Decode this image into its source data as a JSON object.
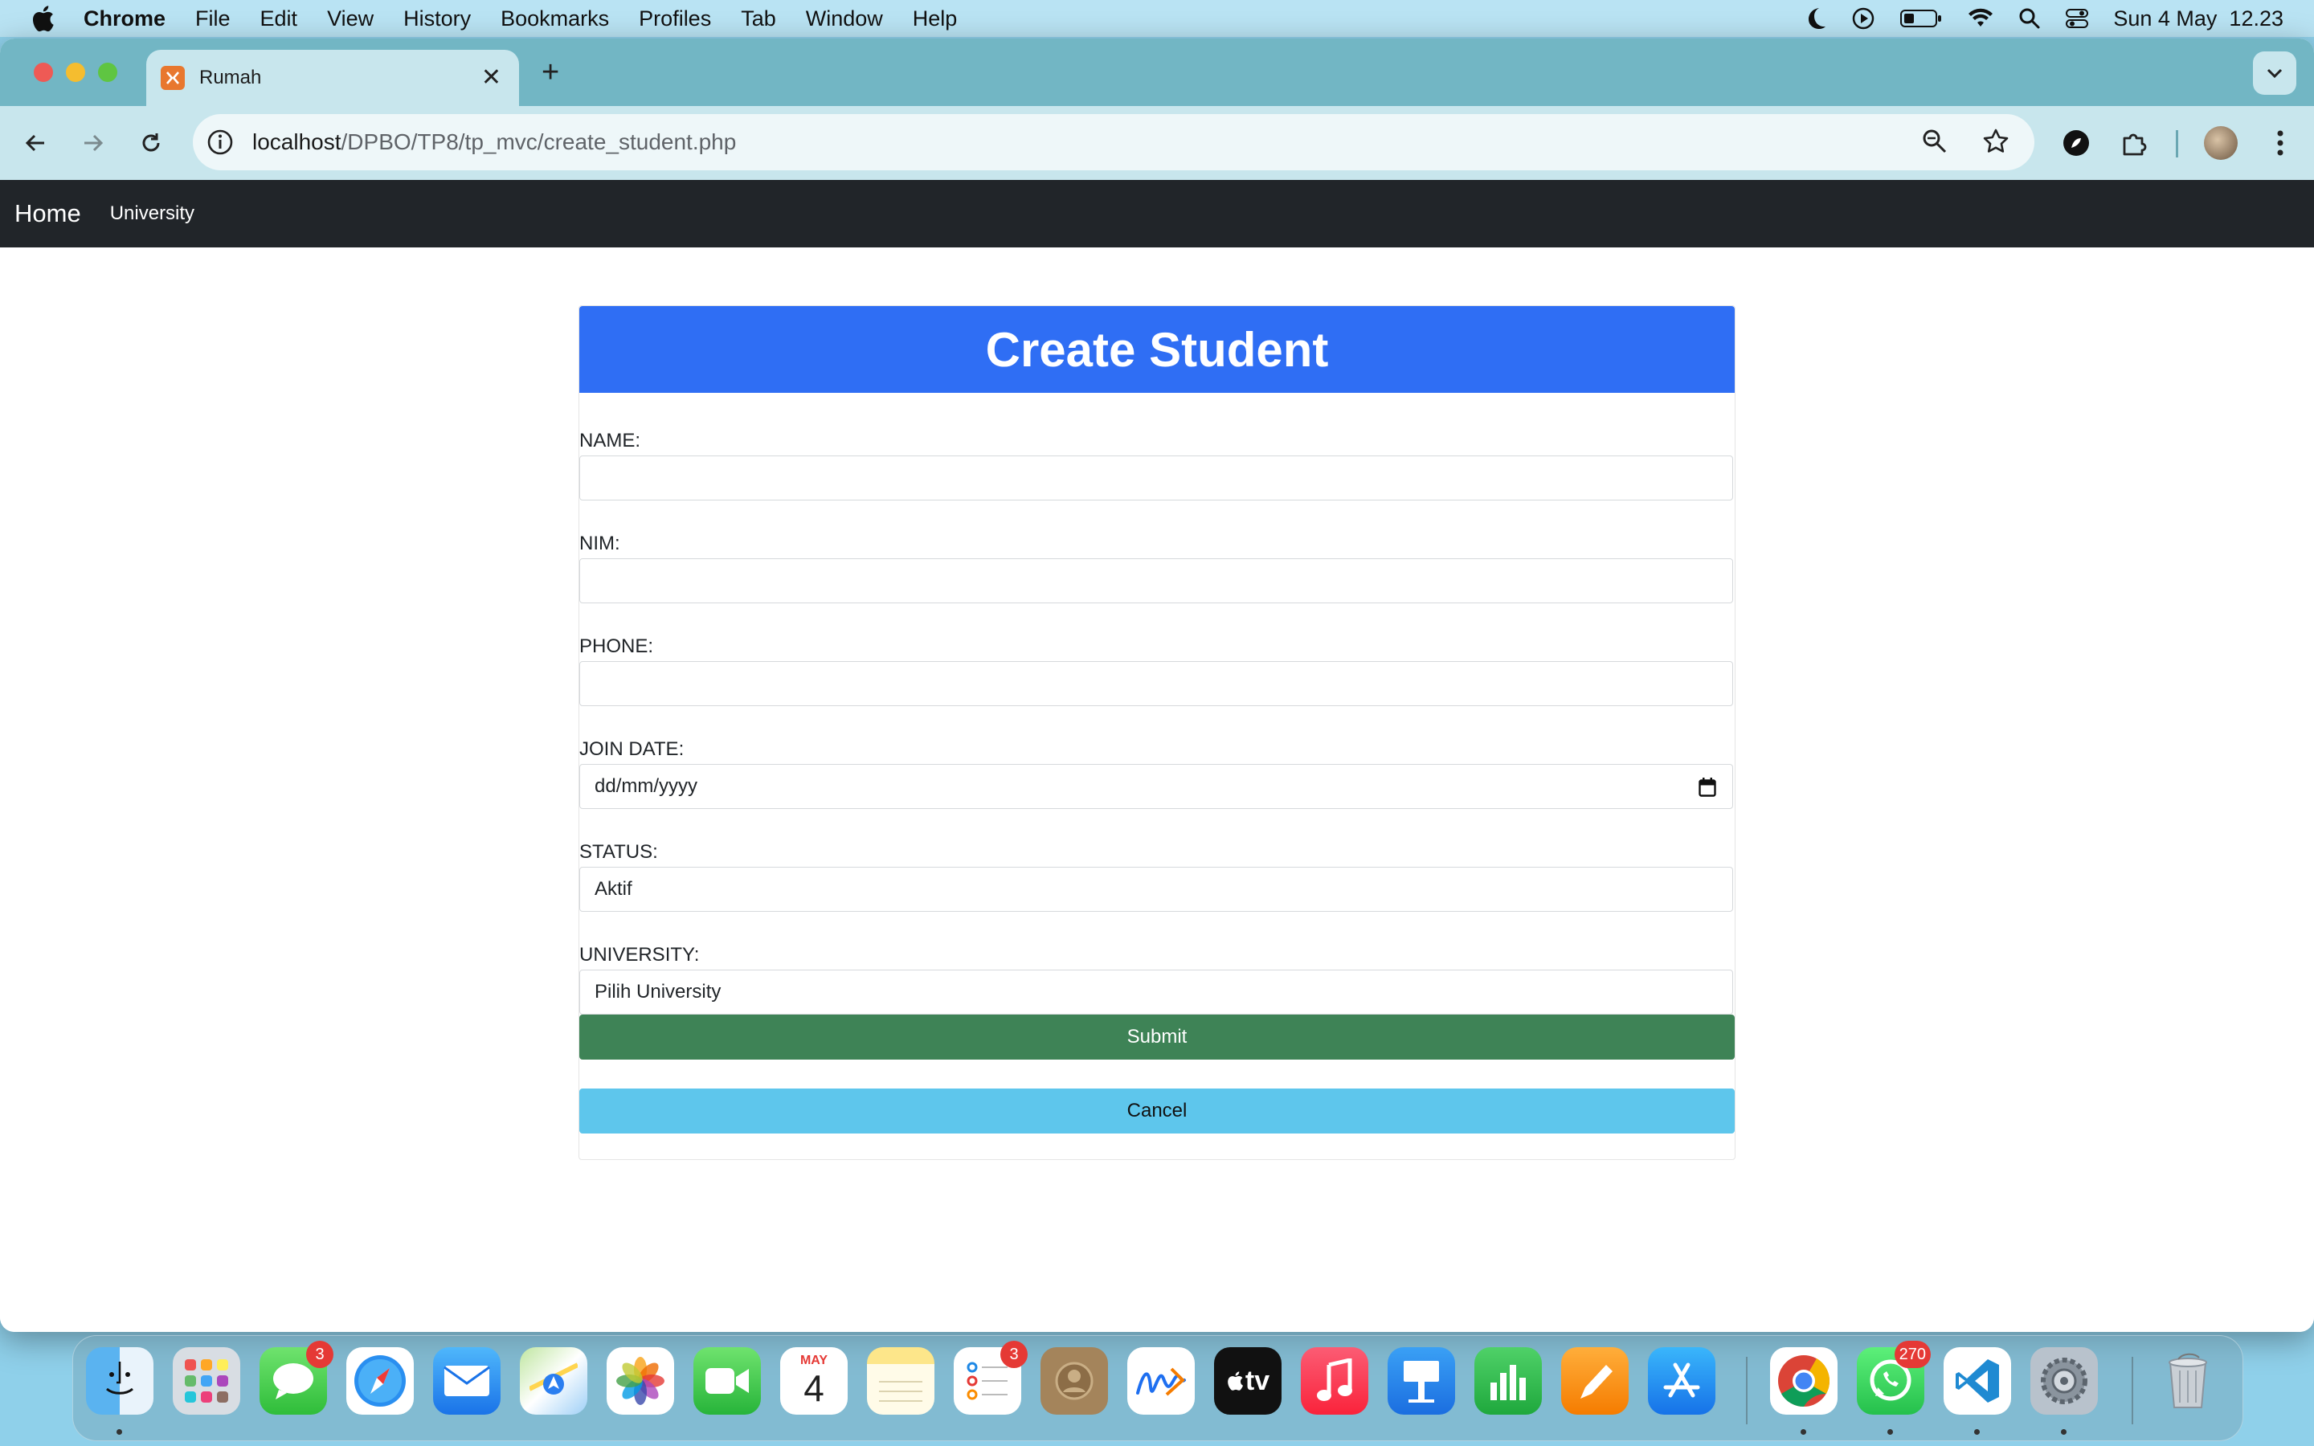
{
  "menubar": {
    "app_name": "Chrome",
    "items": [
      "File",
      "Edit",
      "View",
      "History",
      "Bookmarks",
      "Profiles",
      "Tab",
      "Window",
      "Help"
    ],
    "datetime": "Sun 4 May  12.23"
  },
  "browser": {
    "tab_title": "Rumah",
    "url_host": "localhost",
    "url_path": "/DPBO/TP8/tp_mvc/create_student.php"
  },
  "site_nav": {
    "brand": "Home",
    "links": [
      "University"
    ]
  },
  "form": {
    "title": "Create Student",
    "fields": [
      {
        "label": "NAME:",
        "value": ""
      },
      {
        "label": "NIM:",
        "value": ""
      },
      {
        "label": "PHONE:",
        "value": ""
      },
      {
        "label": "JOIN DATE:",
        "value": "dd/mm/yyyy"
      },
      {
        "label": "STATUS:",
        "value": "Aktif"
      },
      {
        "label": "UNIVERSITY:",
        "value": "Pilih University"
      }
    ],
    "submit_label": "Submit",
    "cancel_label": "Cancel"
  },
  "dock": {
    "apps": [
      {
        "name": "finder-icon"
      },
      {
        "name": "launchpad-icon"
      },
      {
        "name": "messages-icon",
        "badge": "3"
      },
      {
        "name": "safari-icon"
      },
      {
        "name": "mail-icon"
      },
      {
        "name": "maps-icon"
      },
      {
        "name": "photos-icon"
      },
      {
        "name": "facetime-icon"
      },
      {
        "name": "calendar-icon",
        "month": "MAY",
        "day": "4"
      },
      {
        "name": "notes-icon"
      },
      {
        "name": "reminders-icon",
        "badge": "3"
      },
      {
        "name": "contacts-icon"
      },
      {
        "name": "freeform-icon"
      },
      {
        "name": "tv-icon",
        "label": "tv"
      },
      {
        "name": "music-icon"
      },
      {
        "name": "keynote-icon"
      },
      {
        "name": "numbers-icon"
      },
      {
        "name": "pages-icon"
      },
      {
        "name": "app-store-icon"
      },
      {
        "name": "chrome-icon"
      },
      {
        "name": "whatsapp-icon",
        "badge": "270"
      },
      {
        "name": "vscode-icon"
      },
      {
        "name": "system-settings-icon"
      },
      {
        "name": "trash-icon"
      }
    ]
  }
}
